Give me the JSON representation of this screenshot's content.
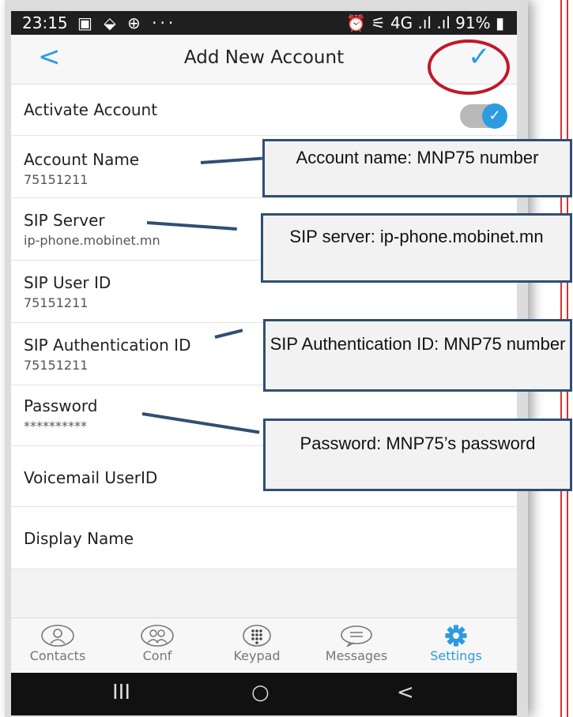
{
  "statusbar": {
    "time": "23:15",
    "left_icons": "▣ ⬙ ⊕ ···",
    "right": "⏰ ⚟ 4G .ıl .ıl 91% ▮"
  },
  "header": {
    "back_glyph": "<",
    "title": "Add New Account",
    "confirm_glyph": "✓"
  },
  "form": {
    "activate": {
      "label": "Activate Account",
      "enabled": true
    },
    "account_name": {
      "label": "Account Name",
      "value": "75151211"
    },
    "sip_server": {
      "label": "SIP Server",
      "value": "ip-phone.mobinet.mn"
    },
    "sip_user_id": {
      "label": "SIP User ID",
      "value": "75151211"
    },
    "sip_auth_id": {
      "label": "SIP Authentication ID",
      "value": "75151211"
    },
    "password": {
      "label": "Password",
      "value": "**********"
    },
    "voicemail": {
      "label": "Voicemail UserID"
    },
    "display_name": {
      "label": "Display Name"
    }
  },
  "tabs": [
    {
      "label": "Contacts",
      "icon": "contacts-icon",
      "active": false
    },
    {
      "label": "Conf",
      "icon": "conference-icon",
      "active": false
    },
    {
      "label": "Keypad",
      "icon": "keypad-icon",
      "active": false
    },
    {
      "label": "Messages",
      "icon": "messages-icon",
      "active": false
    },
    {
      "label": "Settings",
      "icon": "settings-gear-icon",
      "active": true
    }
  ],
  "system_nav": {
    "recents": "III",
    "home": "○",
    "back": "<"
  },
  "callouts": {
    "account_name": "Account name: MNP75 number",
    "sip_server": "SIP server: ip-phone.mobinet.mn",
    "sip_auth": "SIP Authentication ID: MNP75 number",
    "password": "Password: MNP75’s password"
  },
  "colors": {
    "accent": "#2c9be0",
    "callout_border": "#2f4f72",
    "highlight_circle": "#c0182a"
  }
}
